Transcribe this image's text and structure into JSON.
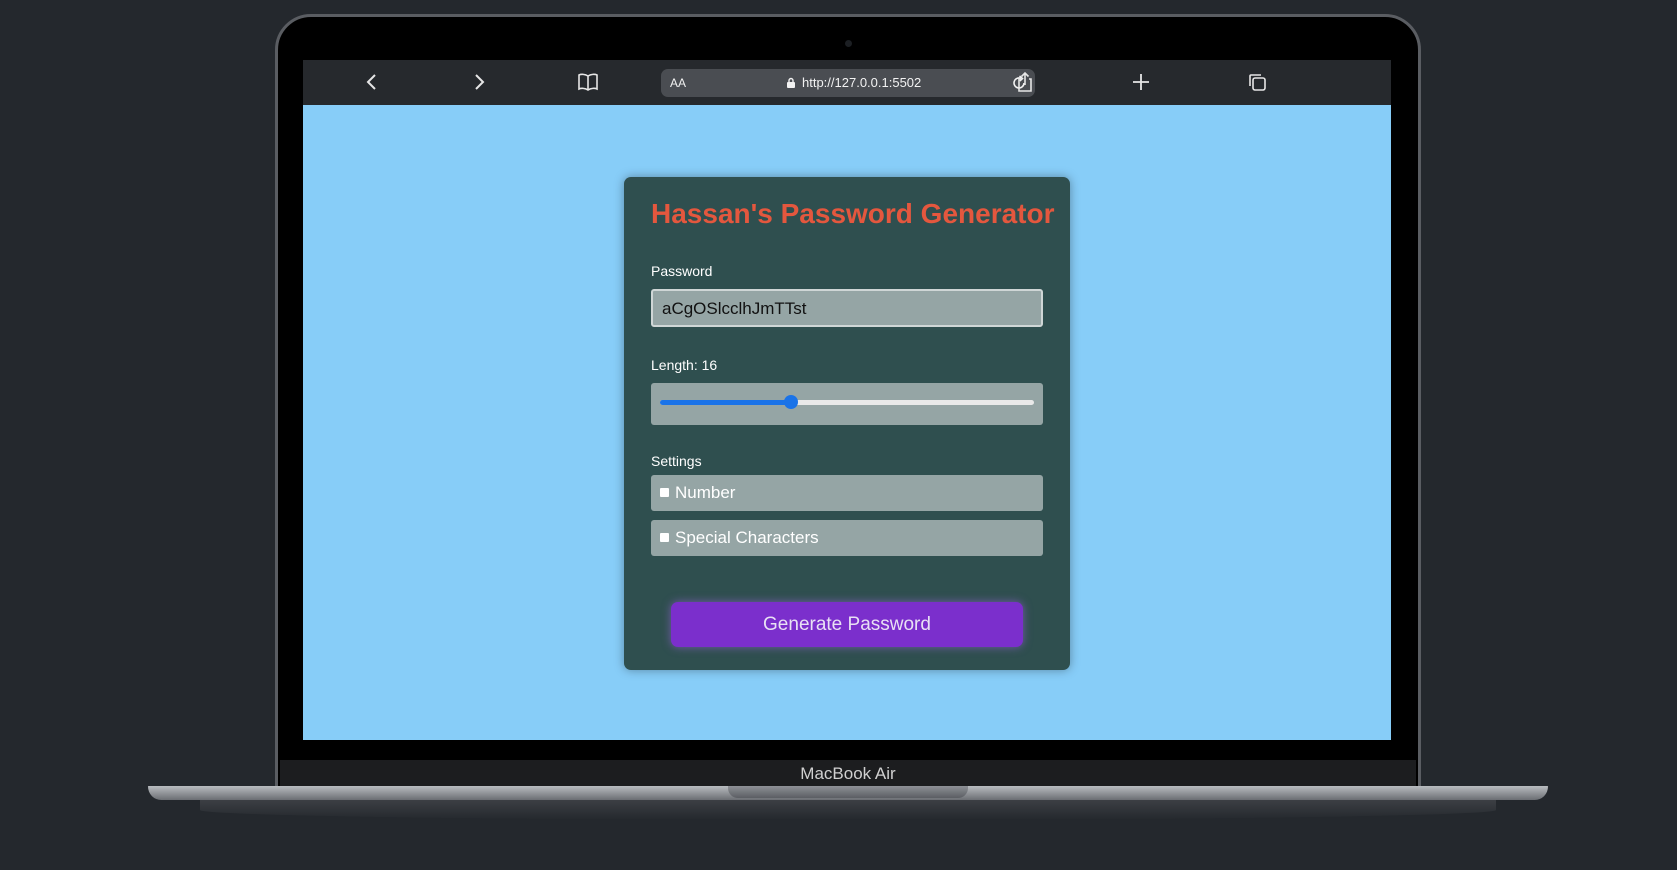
{
  "device": {
    "model_label": "MacBook Air"
  },
  "browser": {
    "text_size_label": "AA",
    "url": "http://127.0.0.1:5502",
    "icons": [
      "chevron-left-icon",
      "chevron-right-icon",
      "book-icon",
      "lock-icon",
      "reload-icon",
      "share-icon",
      "plus-icon",
      "tabs-icon"
    ]
  },
  "app": {
    "title": "Hassan's Password Generator",
    "password_label": "Password",
    "password_value": "aCgOSlcclhJmTTst",
    "length_label": "Length: 16",
    "length_slider_fraction": 0.35,
    "settings_label": "Settings",
    "options": [
      {
        "label": "Number",
        "checked": false
      },
      {
        "label": "Special Characters",
        "checked": false
      }
    ],
    "generate_button_label": "Generate Password"
  },
  "colors": {
    "page_background": "#87cdf8",
    "card_background": "#2f4f4f",
    "title_color": "#e4573e",
    "button_color": "#7b2fcc",
    "slider_accent": "#1a73e8"
  }
}
